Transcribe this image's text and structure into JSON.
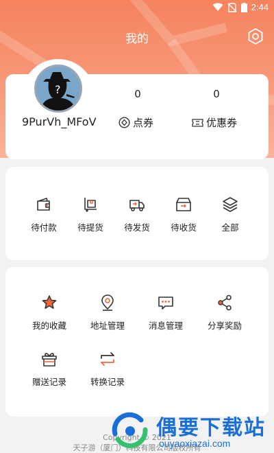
{
  "status": {
    "time": "2:44"
  },
  "header": {
    "title": "我的"
  },
  "profile": {
    "username": "9PurVh_MFoV",
    "points": {
      "value": "0",
      "label": "点券"
    },
    "coupons": {
      "value": "0",
      "label": "优惠券"
    }
  },
  "orders": [
    {
      "label": "待付款",
      "icon": "wallet-icon"
    },
    {
      "label": "待提货",
      "icon": "cart-pickup-icon"
    },
    {
      "label": "待发货",
      "icon": "truck-icon"
    },
    {
      "label": "待收货",
      "icon": "box-receive-icon"
    },
    {
      "label": "全部",
      "icon": "layers-icon"
    }
  ],
  "services": [
    {
      "label": "我的收藏",
      "icon": "star-icon"
    },
    {
      "label": "地址管理",
      "icon": "location-pin-icon"
    },
    {
      "label": "消息管理",
      "icon": "message-icon"
    },
    {
      "label": "分享奖励",
      "icon": "share-icon"
    },
    {
      "label": "赠送记录",
      "icon": "gift-icon"
    },
    {
      "label": "转换记录",
      "icon": "exchange-icon"
    }
  ],
  "footer": {
    "copyright": "Copyright © 2021",
    "company": "天子游（厦门）科技有限公司版权所有"
  },
  "watermark": {
    "title": "偶要下载站",
    "url": "ouyaoxiazai.com"
  },
  "colors": {
    "accent": "#f5835e",
    "icon_accent": "#f0643c",
    "icon_dark": "#333333"
  }
}
